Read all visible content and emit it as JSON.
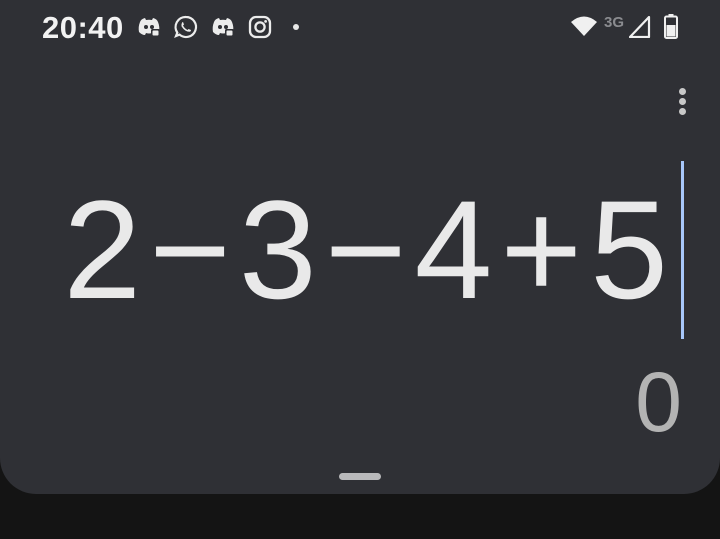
{
  "status_bar": {
    "time": "20:40",
    "notifications": [
      "discord-icon",
      "whatsapp-icon",
      "discord-icon",
      "instagram-icon",
      "more-dot"
    ],
    "network_label": "3G",
    "system_icons": [
      "wifi-icon",
      "signal-icon",
      "battery-icon"
    ]
  },
  "calculator": {
    "expression": "2−3−4+5",
    "result": "0",
    "menu_icon": "more-vert-icon"
  },
  "colors": {
    "panel": "#2f3035",
    "background": "#141414",
    "cursor": "#a8c7fa",
    "expression_text": "#e9e9e9",
    "result_text": "#b3b3b3"
  }
}
